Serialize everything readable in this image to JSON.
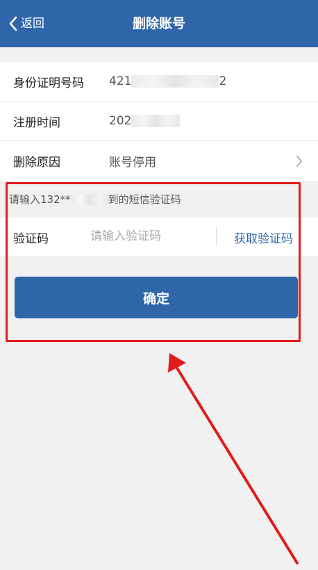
{
  "nav": {
    "back_label": "返回",
    "title": "删除账号"
  },
  "info": {
    "rows": [
      {
        "label": "身份证明号码",
        "value_prefix": "421",
        "value_suffix": "2"
      },
      {
        "label": "注册时间",
        "value_prefix": "202",
        "value_suffix": ""
      },
      {
        "label": "删除原因",
        "value": "账号停用"
      }
    ]
  },
  "sms": {
    "hint_prefix": "请输入132**",
    "hint_suffix": "到的短信验证码",
    "code_label": "验证码",
    "code_placeholder": "请输入验证码",
    "get_code_label": "获取验证码"
  },
  "confirm_label": "确定",
  "colors": {
    "brand": "#2f66a9",
    "highlight": "#e21b1b",
    "background": "#f1f1f1"
  },
  "icons": {
    "back": "chevron-left-icon",
    "row_arrow": "chevron-right-icon"
  }
}
